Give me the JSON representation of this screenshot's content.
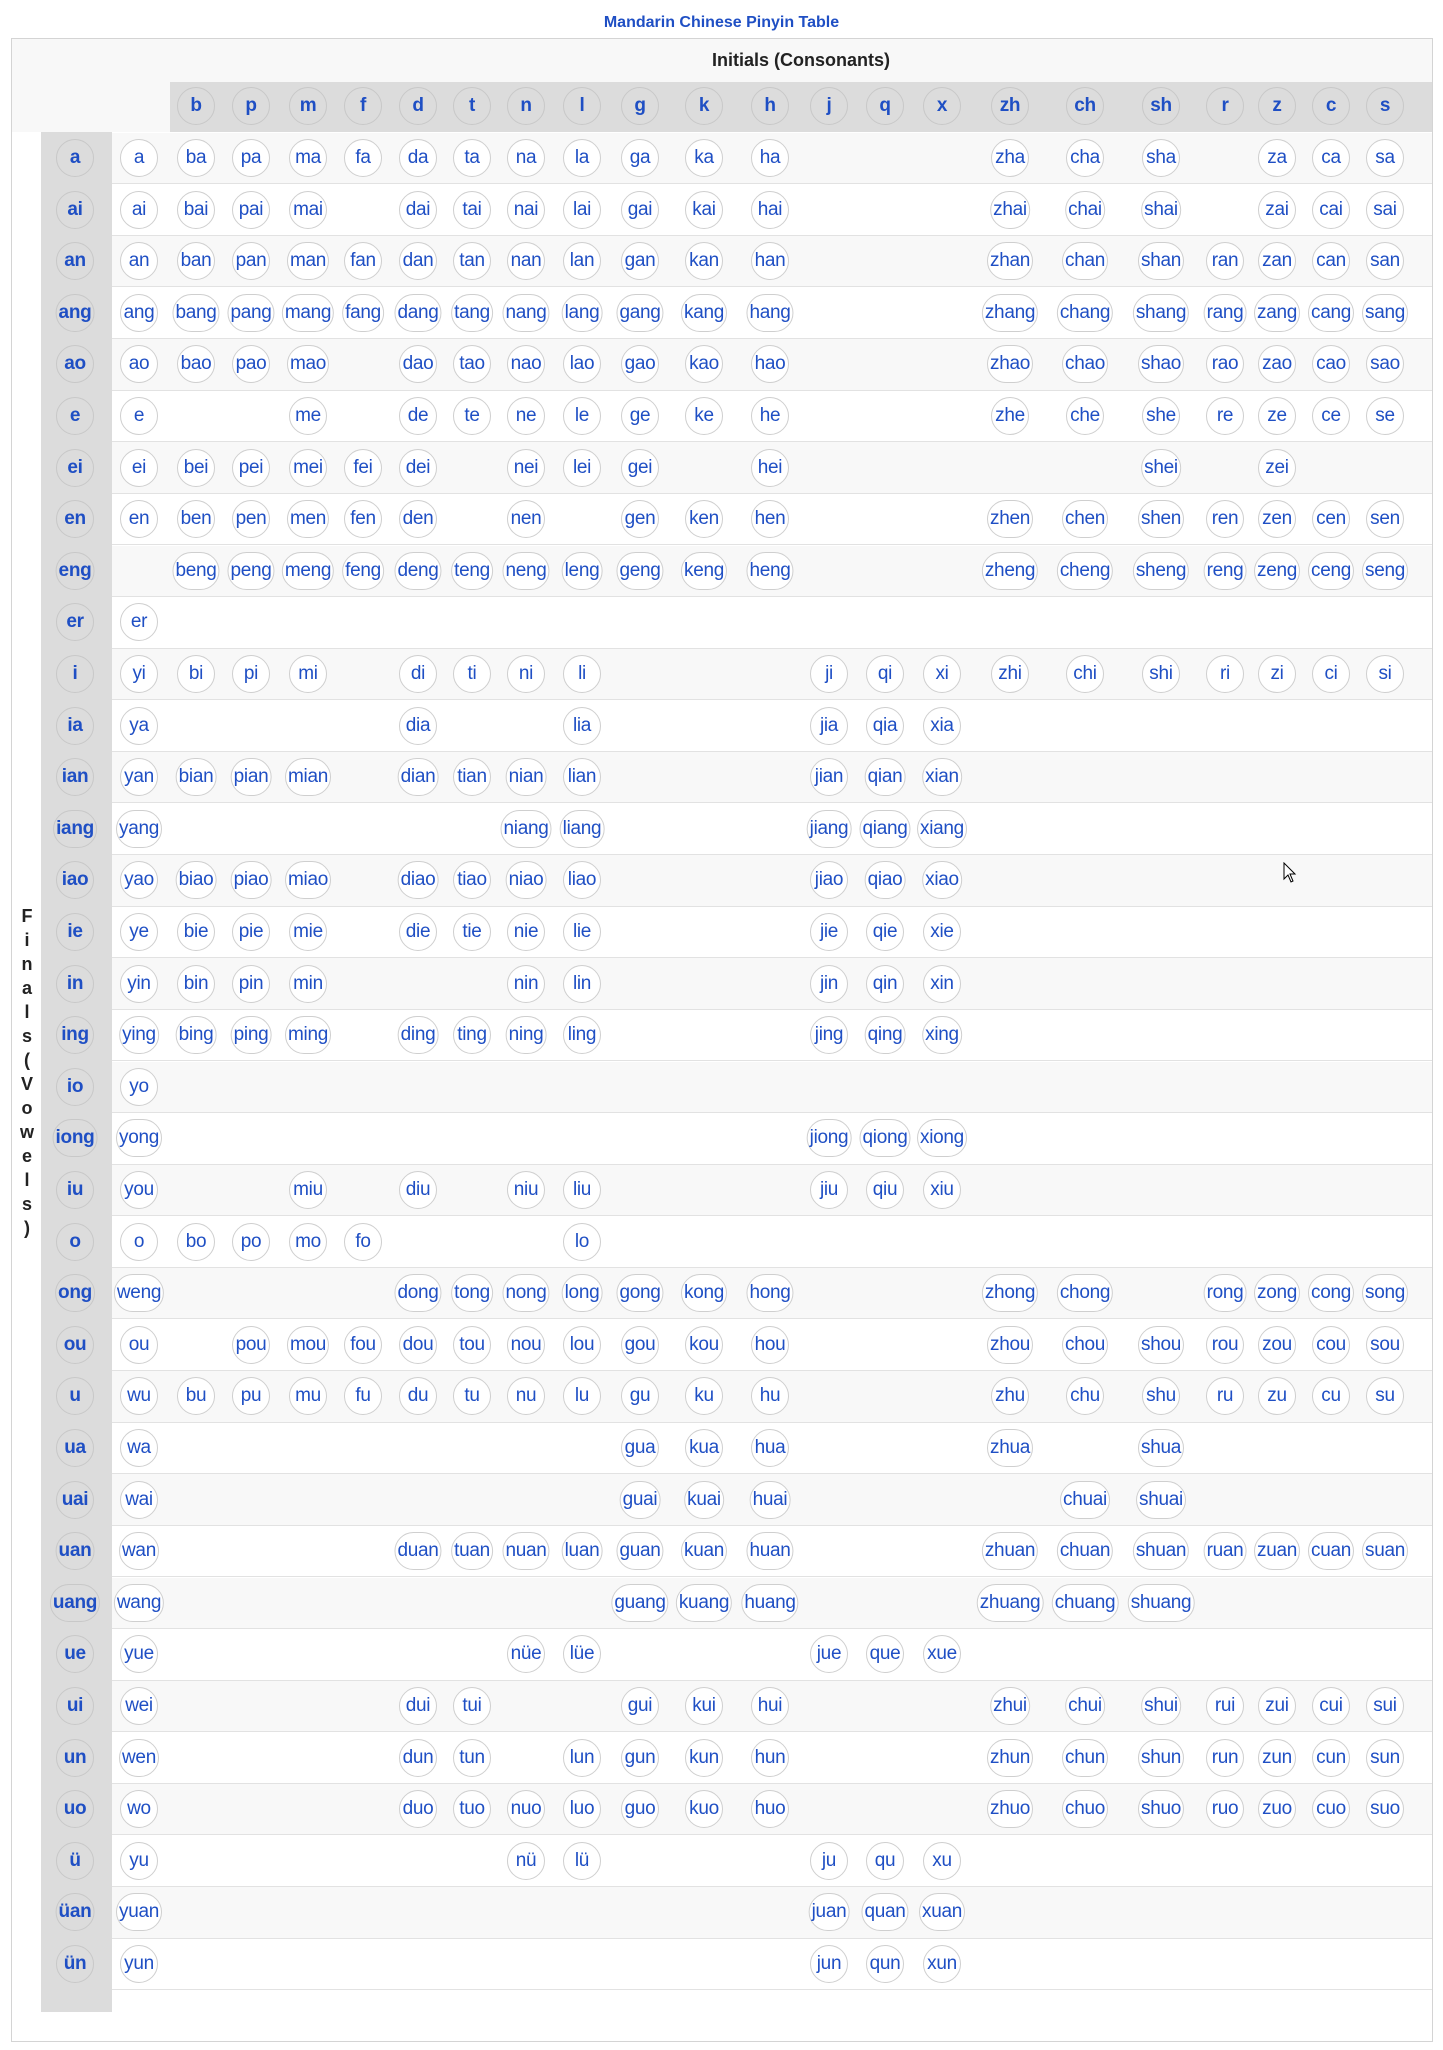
{
  "title": "Mandarin Chinese Pinyin Table",
  "header": {
    "initials_title": "Initials (Consonants)",
    "finals_title": "Finals (Vowels)",
    "initials": [
      "b",
      "p",
      "m",
      "f",
      "d",
      "t",
      "n",
      "l",
      "g",
      "k",
      "h",
      "j",
      "q",
      "x",
      "zh",
      "ch",
      "sh",
      "r",
      "z",
      "c",
      "s"
    ]
  },
  "columns": [
    "",
    "b",
    "p",
    "m",
    "f",
    "d",
    "t",
    "n",
    "l",
    "g",
    "k",
    "h",
    "j",
    "q",
    "x",
    "zh",
    "ch",
    "sh",
    "r",
    "z",
    "c",
    "s"
  ],
  "rows": [
    {
      "final": "a",
      "cells": [
        "a",
        "ba",
        "pa",
        "ma",
        "fa",
        "da",
        "ta",
        "na",
        "la",
        "ga",
        "ka",
        "ha",
        "",
        "",
        "",
        "zha",
        "cha",
        "sha",
        "",
        "za",
        "ca",
        "sa"
      ]
    },
    {
      "final": "ai",
      "cells": [
        "ai",
        "bai",
        "pai",
        "mai",
        "",
        "dai",
        "tai",
        "nai",
        "lai",
        "gai",
        "kai",
        "hai",
        "",
        "",
        "",
        "zhai",
        "chai",
        "shai",
        "",
        "zai",
        "cai",
        "sai"
      ]
    },
    {
      "final": "an",
      "cells": [
        "an",
        "ban",
        "pan",
        "man",
        "fan",
        "dan",
        "tan",
        "nan",
        "lan",
        "gan",
        "kan",
        "han",
        "",
        "",
        "",
        "zhan",
        "chan",
        "shan",
        "ran",
        "zan",
        "can",
        "san"
      ]
    },
    {
      "final": "ang",
      "cells": [
        "ang",
        "bang",
        "pang",
        "mang",
        "fang",
        "dang",
        "tang",
        "nang",
        "lang",
        "gang",
        "kang",
        "hang",
        "",
        "",
        "",
        "zhang",
        "chang",
        "shang",
        "rang",
        "zang",
        "cang",
        "sang"
      ]
    },
    {
      "final": "ao",
      "cells": [
        "ao",
        "bao",
        "pao",
        "mao",
        "",
        "dao",
        "tao",
        "nao",
        "lao",
        "gao",
        "kao",
        "hao",
        "",
        "",
        "",
        "zhao",
        "chao",
        "shao",
        "rao",
        "zao",
        "cao",
        "sao"
      ]
    },
    {
      "final": "e",
      "cells": [
        "e",
        "",
        "",
        "me",
        "",
        "de",
        "te",
        "ne",
        "le",
        "ge",
        "ke",
        "he",
        "",
        "",
        "",
        "zhe",
        "che",
        "she",
        "re",
        "ze",
        "ce",
        "se"
      ]
    },
    {
      "final": "ei",
      "cells": [
        "ei",
        "bei",
        "pei",
        "mei",
        "fei",
        "dei",
        "",
        "nei",
        "lei",
        "gei",
        "",
        "hei",
        "",
        "",
        "",
        "",
        "",
        "shei",
        "",
        "zei",
        "",
        ""
      ]
    },
    {
      "final": "en",
      "cells": [
        "en",
        "ben",
        "pen",
        "men",
        "fen",
        "den",
        "",
        "nen",
        "",
        "gen",
        "ken",
        "hen",
        "",
        "",
        "",
        "zhen",
        "chen",
        "shen",
        "ren",
        "zen",
        "cen",
        "sen"
      ]
    },
    {
      "final": "eng",
      "cells": [
        "",
        "beng",
        "peng",
        "meng",
        "feng",
        "deng",
        "teng",
        "neng",
        "leng",
        "geng",
        "keng",
        "heng",
        "",
        "",
        "",
        "zheng",
        "cheng",
        "sheng",
        "reng",
        "zeng",
        "ceng",
        "seng"
      ]
    },
    {
      "final": "er",
      "cells": [
        "er",
        "",
        "",
        "",
        "",
        "",
        "",
        "",
        "",
        "",
        "",
        "",
        "",
        "",
        "",
        "",
        "",
        "",
        "",
        "",
        "",
        ""
      ]
    },
    {
      "final": "i",
      "cells": [
        "yi",
        "bi",
        "pi",
        "mi",
        "",
        "di",
        "ti",
        "ni",
        "li",
        "",
        "",
        "",
        "ji",
        "qi",
        "xi",
        "zhi",
        "chi",
        "shi",
        "ri",
        "zi",
        "ci",
        "si"
      ]
    },
    {
      "final": "ia",
      "cells": [
        "ya",
        "",
        "",
        "",
        "",
        "dia",
        "",
        "",
        "lia",
        "",
        "",
        "",
        "jia",
        "qia",
        "xia",
        "",
        "",
        "",
        "",
        "",
        "",
        ""
      ]
    },
    {
      "final": "ian",
      "cells": [
        "yan",
        "bian",
        "pian",
        "mian",
        "",
        "dian",
        "tian",
        "nian",
        "lian",
        "",
        "",
        "",
        "jian",
        "qian",
        "xian",
        "",
        "",
        "",
        "",
        "",
        "",
        ""
      ]
    },
    {
      "final": "iang",
      "cells": [
        "yang",
        "",
        "",
        "",
        "",
        "",
        "",
        "niang",
        "liang",
        "",
        "",
        "",
        "jiang",
        "qiang",
        "xiang",
        "",
        "",
        "",
        "",
        "",
        "",
        ""
      ]
    },
    {
      "final": "iao",
      "cells": [
        "yao",
        "biao",
        "piao",
        "miao",
        "",
        "diao",
        "tiao",
        "niao",
        "liao",
        "",
        "",
        "",
        "jiao",
        "qiao",
        "xiao",
        "",
        "",
        "",
        "",
        "",
        "",
        ""
      ]
    },
    {
      "final": "ie",
      "cells": [
        "ye",
        "bie",
        "pie",
        "mie",
        "",
        "die",
        "tie",
        "nie",
        "lie",
        "",
        "",
        "",
        "jie",
        "qie",
        "xie",
        "",
        "",
        "",
        "",
        "",
        "",
        ""
      ]
    },
    {
      "final": "in",
      "cells": [
        "yin",
        "bin",
        "pin",
        "min",
        "",
        "",
        "",
        "nin",
        "lin",
        "",
        "",
        "",
        "jin",
        "qin",
        "xin",
        "",
        "",
        "",
        "",
        "",
        "",
        ""
      ]
    },
    {
      "final": "ing",
      "cells": [
        "ying",
        "bing",
        "ping",
        "ming",
        "",
        "ding",
        "ting",
        "ning",
        "ling",
        "",
        "",
        "",
        "jing",
        "qing",
        "xing",
        "",
        "",
        "",
        "",
        "",
        "",
        ""
      ]
    },
    {
      "final": "io",
      "cells": [
        "yo",
        "",
        "",
        "",
        "",
        "",
        "",
        "",
        "",
        "",
        "",
        "",
        "",
        "",
        "",
        "",
        "",
        "",
        "",
        "",
        "",
        ""
      ]
    },
    {
      "final": "iong",
      "cells": [
        "yong",
        "",
        "",
        "",
        "",
        "",
        "",
        "",
        "",
        "",
        "",
        "",
        "jiong",
        "qiong",
        "xiong",
        "",
        "",
        "",
        "",
        "",
        "",
        ""
      ]
    },
    {
      "final": "iu",
      "cells": [
        "you",
        "",
        "",
        "miu",
        "",
        "diu",
        "",
        "niu",
        "liu",
        "",
        "",
        "",
        "jiu",
        "qiu",
        "xiu",
        "",
        "",
        "",
        "",
        "",
        "",
        ""
      ]
    },
    {
      "final": "o",
      "cells": [
        "o",
        "bo",
        "po",
        "mo",
        "fo",
        "",
        "",
        "",
        "lo",
        "",
        "",
        "",
        "",
        "",
        "",
        "",
        "",
        "",
        "",
        "",
        "",
        ""
      ]
    },
    {
      "final": "ong",
      "cells": [
        "weng",
        "",
        "",
        "",
        "",
        "dong",
        "tong",
        "nong",
        "long",
        "gong",
        "kong",
        "hong",
        "",
        "",
        "",
        "zhong",
        "chong",
        "",
        "rong",
        "zong",
        "cong",
        "song"
      ]
    },
    {
      "final": "ou",
      "cells": [
        "ou",
        "",
        "pou",
        "mou",
        "fou",
        "dou",
        "tou",
        "nou",
        "lou",
        "gou",
        "kou",
        "hou",
        "",
        "",
        "",
        "zhou",
        "chou",
        "shou",
        "rou",
        "zou",
        "cou",
        "sou"
      ]
    },
    {
      "final": "u",
      "cells": [
        "wu",
        "bu",
        "pu",
        "mu",
        "fu",
        "du",
        "tu",
        "nu",
        "lu",
        "gu",
        "ku",
        "hu",
        "",
        "",
        "",
        "zhu",
        "chu",
        "shu",
        "ru",
        "zu",
        "cu",
        "su"
      ]
    },
    {
      "final": "ua",
      "cells": [
        "wa",
        "",
        "",
        "",
        "",
        "",
        "",
        "",
        "",
        "gua",
        "kua",
        "hua",
        "",
        "",
        "",
        "zhua",
        "",
        "shua",
        "",
        "",
        "",
        ""
      ]
    },
    {
      "final": "uai",
      "cells": [
        "wai",
        "",
        "",
        "",
        "",
        "",
        "",
        "",
        "",
        "guai",
        "kuai",
        "huai",
        "",
        "",
        "",
        "",
        "chuai",
        "shuai",
        "",
        "",
        "",
        ""
      ]
    },
    {
      "final": "uan",
      "cells": [
        "wan",
        "",
        "",
        "",
        "",
        "duan",
        "tuan",
        "nuan",
        "luan",
        "guan",
        "kuan",
        "huan",
        "",
        "",
        "",
        "zhuan",
        "chuan",
        "shuan",
        "ruan",
        "zuan",
        "cuan",
        "suan"
      ]
    },
    {
      "final": "uang",
      "cells": [
        "wang",
        "",
        "",
        "",
        "",
        "",
        "",
        "",
        "",
        "guang",
        "kuang",
        "huang",
        "",
        "",
        "",
        "zhuang",
        "chuang",
        "shuang",
        "",
        "",
        "",
        ""
      ]
    },
    {
      "final": "ue",
      "cells": [
        "yue",
        "",
        "",
        "",
        "",
        "",
        "",
        "nüe",
        "lüe",
        "",
        "",
        "",
        "jue",
        "que",
        "xue",
        "",
        "",
        "",
        "",
        "",
        "",
        ""
      ]
    },
    {
      "final": "ui",
      "cells": [
        "wei",
        "",
        "",
        "",
        "",
        "dui",
        "tui",
        "",
        "",
        "gui",
        "kui",
        "hui",
        "",
        "",
        "",
        "zhui",
        "chui",
        "shui",
        "rui",
        "zui",
        "cui",
        "sui"
      ]
    },
    {
      "final": "un",
      "cells": [
        "wen",
        "",
        "",
        "",
        "",
        "dun",
        "tun",
        "",
        "lun",
        "gun",
        "kun",
        "hun",
        "",
        "",
        "",
        "zhun",
        "chun",
        "shun",
        "run",
        "zun",
        "cun",
        "sun"
      ]
    },
    {
      "final": "uo",
      "cells": [
        "wo",
        "",
        "",
        "",
        "",
        "duo",
        "tuo",
        "nuo",
        "luo",
        "guo",
        "kuo",
        "huo",
        "",
        "",
        "",
        "zhuo",
        "chuo",
        "shuo",
        "ruo",
        "zuo",
        "cuo",
        "suo"
      ]
    },
    {
      "final": "ü",
      "cells": [
        "yu",
        "",
        "",
        "",
        "",
        "",
        "",
        "nü",
        "lü",
        "",
        "",
        "",
        "ju",
        "qu",
        "xu",
        "",
        "",
        "",
        "",
        "",
        "",
        ""
      ]
    },
    {
      "final": "üan",
      "cells": [
        "yuan",
        "",
        "",
        "",
        "",
        "",
        "",
        "",
        "",
        "",
        "",
        "",
        "juan",
        "quan",
        "xuan",
        "",
        "",
        "",
        "",
        "",
        "",
        ""
      ]
    },
    {
      "final": "ün",
      "cells": [
        "yun",
        "",
        "",
        "",
        "",
        "",
        "",
        "",
        "",
        "",
        "",
        "",
        "jun",
        "qun",
        "xun",
        "",
        "",
        "",
        "",
        "",
        "",
        ""
      ]
    }
  ],
  "colors": {
    "link": "#1f4fc4",
    "band": "#dcdcdc",
    "row_alt": "#f8f8f8",
    "bubble_border": "#cfcfcf"
  }
}
